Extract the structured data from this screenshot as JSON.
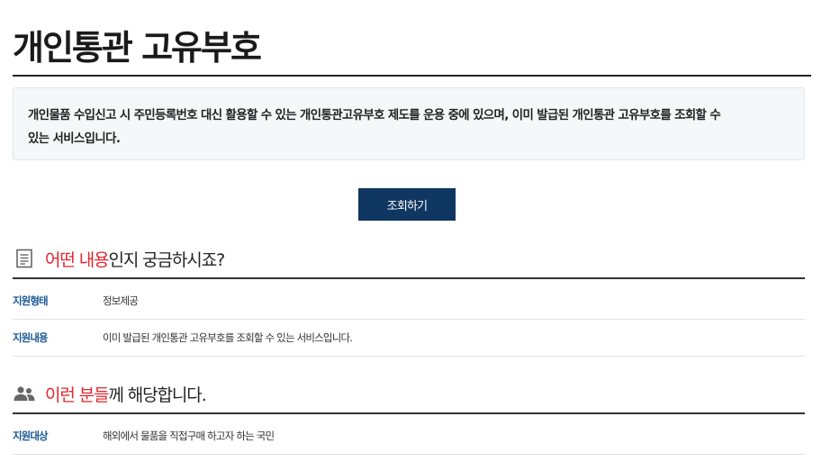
{
  "page": {
    "title": "개인통관 고유부호",
    "intro_line1": "개인물품 수입신고 시 주민등록번호 대신 활용할 수 있는 개인통관고유부호 제도를 운용 중에 있으며, 이미 발급된 개인통관 고유부호를 조회할 수",
    "intro_line2": "있는 서비스입니다.",
    "lookup_button": "조회하기"
  },
  "sections": [
    {
      "icon": "document-icon",
      "heading_accent": "어떤 내용",
      "heading_rest": "인지 궁금하시죠?",
      "rows": [
        {
          "label": "지원형태",
          "value": "정보제공"
        },
        {
          "label": "지원내용",
          "value": "이미 발급된 개인통관 고유부호를 조회할 수 있는 서비스입니다."
        }
      ]
    },
    {
      "icon": "people-icon",
      "heading_accent": "이런 분들",
      "heading_rest": "께 해당합니다.",
      "rows": [
        {
          "label": "지원대상",
          "value": "해외에서 물품을 직접구매 하고자 하는 국민"
        }
      ]
    }
  ],
  "colors": {
    "accent_red": "#e2262e",
    "button_navy": "#0f3761",
    "label_blue": "#1d5a96",
    "icon_gray": "#666666"
  }
}
